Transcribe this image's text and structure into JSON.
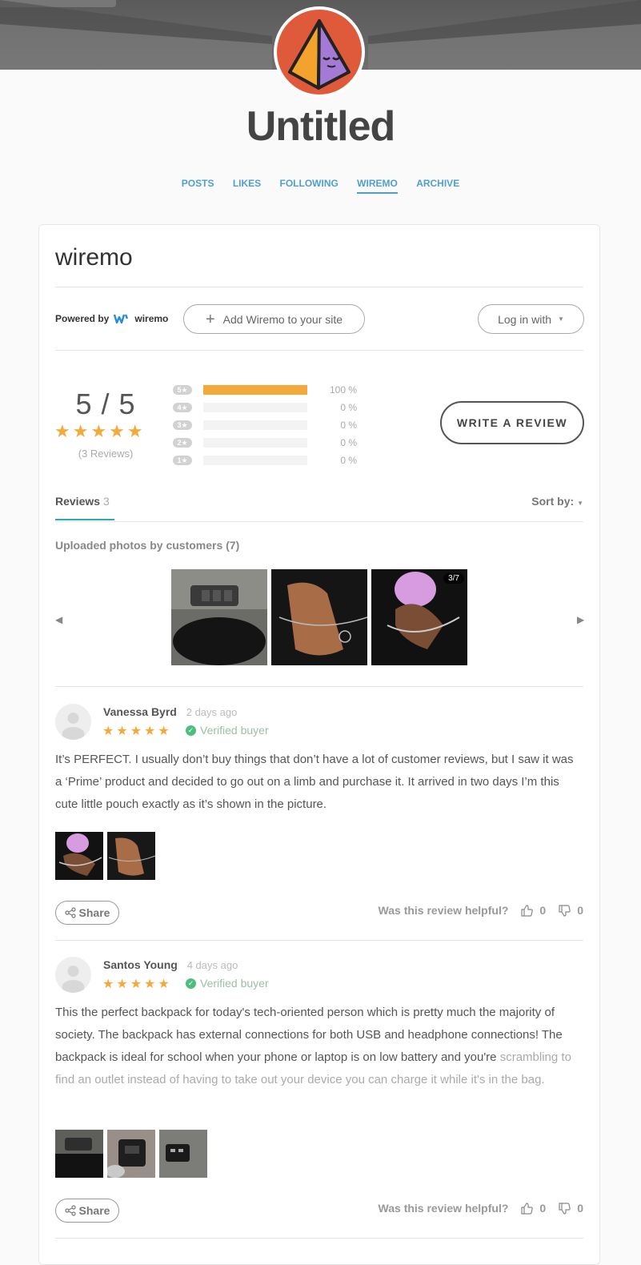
{
  "blog": {
    "title": "Untitled",
    "nav": [
      "POSTS",
      "LIKES",
      "FOLLOWING",
      "WIREMO",
      "ARCHIVE"
    ],
    "active_nav": "WIREMO"
  },
  "widget": {
    "title": "wiremo",
    "powered_by": "Powered by",
    "brand": "wiremo",
    "add_button": "Add Wiremo to your site",
    "login_button": "Log in with",
    "write_review": "WRITE A REVIEW"
  },
  "summary": {
    "score": "5 / 5",
    "stars": "★★★★★",
    "count_text": "(3 Reviews)",
    "distribution": [
      {
        "label": "5★",
        "fraction": 1.0,
        "pct": "100 %"
      },
      {
        "label": "4★",
        "fraction": 0,
        "pct": "0 %"
      },
      {
        "label": "3★",
        "fraction": 0,
        "pct": "0 %"
      },
      {
        "label": "2★",
        "fraction": 0,
        "pct": "0 %"
      },
      {
        "label": "1★",
        "fraction": 0,
        "pct": "0 %"
      }
    ],
    "bar_color": "#f4a93a"
  },
  "tabs": {
    "reviews_label": "Reviews",
    "reviews_count": "3",
    "sort_label": "Sort by:"
  },
  "photos": {
    "heading": "Uploaded photos by customers (7)",
    "counter": "3/7"
  },
  "reviews": [
    {
      "name": "Vanessa Byrd",
      "date": "2 days ago",
      "stars": "★★★★★",
      "verified": "Verified buyer",
      "body": "It’s PERFECT. I usually don’t buy things that don’t have a lot of customer reviews, but I saw it was a ‘Prime’ product and decided to go out on a limb and purchase it. It arrived in two days I’m this cute little pouch exactly as it’s shown in the picture.",
      "body_fade": "",
      "share": "Share",
      "helpful": "Was this review helpful?",
      "up": "0",
      "down": "0"
    },
    {
      "name": "Santos Young",
      "date": "4 days ago",
      "stars": "★★★★★",
      "verified": "Verified buyer",
      "body": "This the perfect backpack for today's tech-oriented person which is pretty much the majority of society. The backpack has external connections for both USB and headphone connections! The backpack is ideal for school when your phone or laptop is on low battery and you're",
      "body_fade": "scrambling to find an outlet instead of having to take out your device you can charge it while it's in the bag.",
      "share": "Share",
      "helpful": "Was this review helpful?",
      "up": "0",
      "down": "0"
    }
  ],
  "colors": {
    "accent": "#4f9fcf",
    "star": "#f4a93a",
    "verified": "#4cbf7e",
    "avatar_bg": "#df5a3a"
  }
}
